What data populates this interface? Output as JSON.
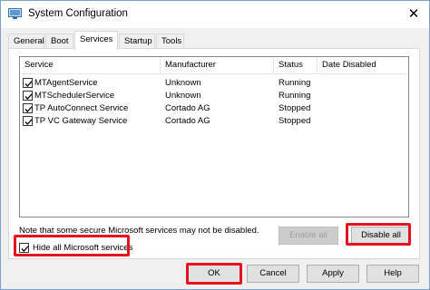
{
  "window": {
    "title": "System Configuration",
    "close_glyph": "✕"
  },
  "tabs": [
    {
      "label": "General",
      "active": false
    },
    {
      "label": "Boot",
      "active": false
    },
    {
      "label": "Services",
      "active": true
    },
    {
      "label": "Startup",
      "active": false
    },
    {
      "label": "Tools",
      "active": false
    }
  ],
  "services_table": {
    "columns": [
      "Service",
      "Manufacturer",
      "Status",
      "Date Disabled"
    ],
    "rows": [
      {
        "checked": true,
        "service": "MTAgentService",
        "manufacturer": "Unknown",
        "status": "Running",
        "date_disabled": ""
      },
      {
        "checked": true,
        "service": "MTSchedulerService",
        "manufacturer": "Unknown",
        "status": "Running",
        "date_disabled": ""
      },
      {
        "checked": true,
        "service": "TP AutoConnect Service",
        "manufacturer": "Cortado AG",
        "status": "Stopped",
        "date_disabled": ""
      },
      {
        "checked": true,
        "service": "TP VC Gateway Service",
        "manufacturer": "Cortado AG",
        "status": "Stopped",
        "date_disabled": ""
      }
    ]
  },
  "note": "Note that some secure Microsoft services may not be disabled.",
  "hide_microsoft": {
    "label": "Hide all Microsoft services",
    "checked": true
  },
  "buttons": {
    "enable_all": "Enable all",
    "disable_all": "Disable all",
    "ok": "OK",
    "cancel": "Cancel",
    "apply": "Apply",
    "help": "Help"
  },
  "colors": {
    "highlight": "#e8121d",
    "accent": "#0078d7"
  }
}
